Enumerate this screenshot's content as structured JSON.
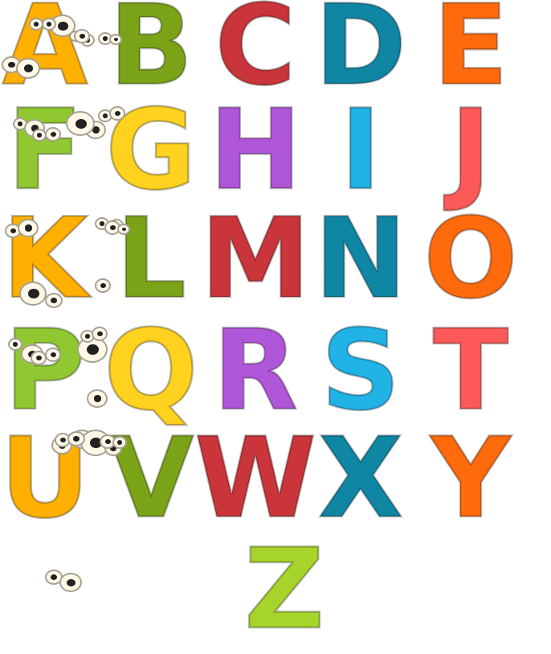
{
  "letters": [
    {
      "char": "A",
      "color": "#ffb000"
    },
    {
      "char": "B",
      "color": "#7ba317"
    },
    {
      "char": "C",
      "color": "#c9353a"
    },
    {
      "char": "D",
      "color": "#0f86a4"
    },
    {
      "char": "E",
      "color": "#ff6a0d"
    },
    {
      "char": "F",
      "color": "#91c832"
    },
    {
      "char": "G",
      "color": "#ffd21f"
    },
    {
      "char": "H",
      "color": "#b056d8"
    },
    {
      "char": "I",
      "color": "#21b2e6"
    },
    {
      "char": "J",
      "color": "#fd5959"
    },
    {
      "char": "K",
      "color": "#ffb000"
    },
    {
      "char": "L",
      "color": "#7ba317"
    },
    {
      "char": "M",
      "color": "#c9353a"
    },
    {
      "char": "N",
      "color": "#0f86a4"
    },
    {
      "char": "O",
      "color": "#ff6a0d"
    },
    {
      "char": "P",
      "color": "#91c832"
    },
    {
      "char": "Q",
      "color": "#ffd21f"
    },
    {
      "char": "R",
      "color": "#b056d8"
    },
    {
      "char": "S",
      "color": "#21b2e6"
    },
    {
      "char": "T",
      "color": "#fd5959"
    },
    {
      "char": "U",
      "color": "#ffb000"
    },
    {
      "char": "V",
      "color": "#7ba317"
    },
    {
      "char": "W",
      "color": "#c9353a"
    },
    {
      "char": "X",
      "color": "#0f86a4"
    },
    {
      "char": "Y",
      "color": "#ff6a0d"
    },
    {
      "char": "Z",
      "color": "#a7d42a"
    }
  ],
  "eye_color": "#fff8e6",
  "pupil_color": "#222222"
}
